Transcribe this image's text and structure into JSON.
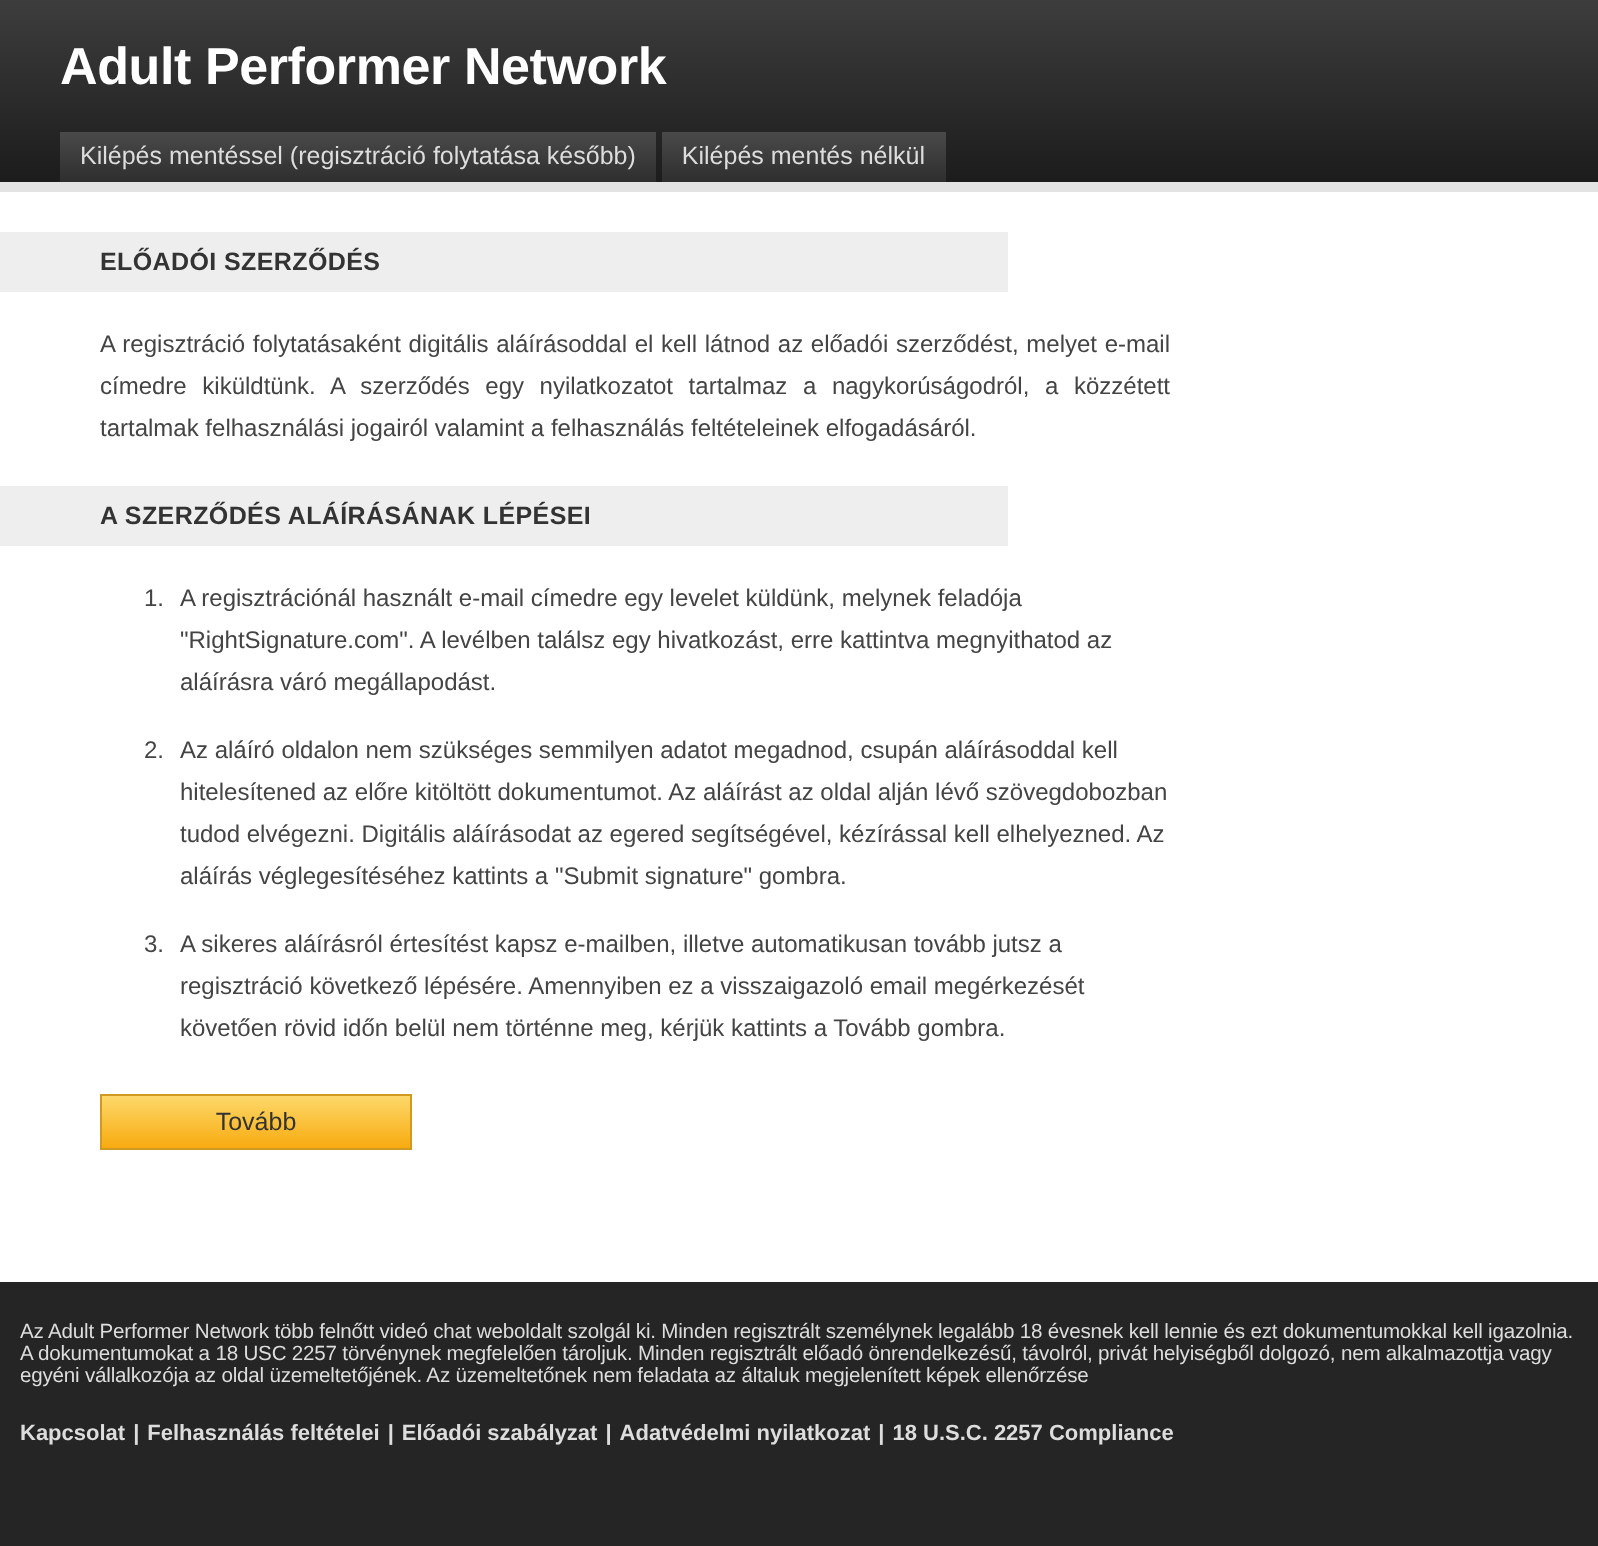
{
  "header": {
    "title": "Adult Performer Network"
  },
  "tabs": [
    {
      "label": "Kilépés mentéssel (regisztráció folytatása később)"
    },
    {
      "label": "Kilépés mentés nélkül"
    }
  ],
  "sections": [
    {
      "heading": "ELŐADÓI SZERZŐDÉS",
      "kind": "paragraph",
      "text": "A regisztráció folytatásaként digitális aláírásoddal el kell látnod az előadói szerződést, melyet e-mail címedre kiküldtünk. A szerződés egy nyilatkozatot tartalmaz a nagykorúságodról, a közzétett tartalmak felhasználási jogairól valamint a felhasználás feltételeinek elfogadásáról."
    },
    {
      "heading": "A SZERZŐDÉS ALÁÍRÁSÁNAK LÉPÉSEI",
      "kind": "steps",
      "steps": [
        {
          "number": "1.",
          "text": "A regisztrációnál használt e-mail címedre egy levelet küldünk, melynek feladója \"RightSignature.com\". A levélben találsz egy hivatkozást, erre kattintva megnyithatod az aláírásra váró megállapodást."
        },
        {
          "number": "2.",
          "text": "Az aláíró oldalon nem szükséges semmilyen adatot megadnod, csupán aláírásoddal kell hitelesítened az előre kitöltött dokumentumot. Az aláírást az oldal alján lévő szövegdobozban tudod elvégezni. Digitális aláírásodat az egered segítségével, kézírással kell elhelyezned. Az aláírás véglegesítéséhez kattints a \"Submit signature\" gombra."
        },
        {
          "number": "3.",
          "text": "A sikeres aláírásról értesítést kapsz e-mailben, illetve automatikusan tovább jutsz a regisztráció következő lépésére. Amennyiben ez a visszaigazoló email megérkezését követően rövid időn belül nem történne meg, kérjük kattints a Tovább gombra."
        }
      ]
    }
  ],
  "next_button": "Tovább",
  "footer": {
    "text": "Az Adult Performer Network több felnőtt videó chat weboldalt szolgál ki. Minden regisztrált személynek legalább 18 évesnek kell lennie és ezt dokumentumokkal kell igazolnia. A dokumentumokat a 18 USC 2257 törvénynek megfelelően tároljuk. Minden regisztrált előadó önrendelkezésű, távolról, privát helyiségből dolgozó, nem alkalmazottja vagy egyéni vállalkozója az oldal üzemeltetőjének. Az üzemeltetőnek nem feladata az általuk megjelenített képek ellenőrzése",
    "links": [
      "Kapcsolat",
      "Felhasználás feltételei",
      "Előadói szabályzat",
      "Adatvédelmi nyilatkozat",
      "18 U.S.C. 2257 Compliance"
    ],
    "separator": "|"
  }
}
